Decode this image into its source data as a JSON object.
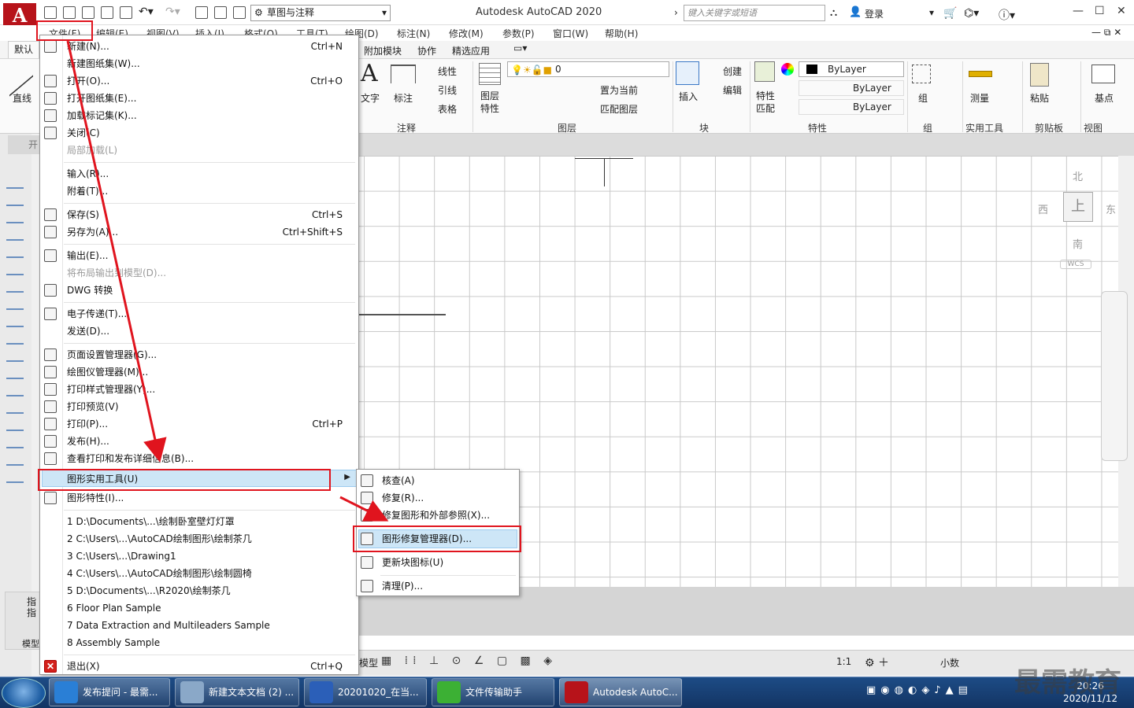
{
  "app": {
    "title": "Autodesk AutoCAD 2020",
    "logo_letter": "A",
    "workspace": "草图与注释",
    "search_placeholder": "键入关键字或短语",
    "login": "登录"
  },
  "menubar": [
    "文件(F)",
    "编辑(E)",
    "视图(V)",
    "插入(I)",
    "格式(O)",
    "工具(T)",
    "绘图(D)",
    "标注(N)",
    "修改(M)",
    "参数(P)",
    "窗口(W)",
    "帮助(H)"
  ],
  "ribbon": {
    "tabs": [
      "默认",
      "附加模块",
      "协作",
      "精选应用"
    ],
    "tools": {
      "line": "直线",
      "text": "文字",
      "dimension": "标注",
      "linear": "线性",
      "leader": "引线",
      "table": "表格",
      "layer_props": "图层特性",
      "layer_value": "0",
      "set_current": "置为当前",
      "match_layer": "匹配图层",
      "insert": "插入",
      "create": "创建",
      "edit": "编辑",
      "match_props": "特性匹配",
      "bylayer_1": "ByLayer",
      "bylayer_2": "ByLayer",
      "bylayer_3": "ByLayer",
      "group": "组",
      "measure": "测量",
      "paste": "粘贴",
      "base": "基点"
    },
    "groups": [
      "注释",
      "图层",
      "块",
      "特性",
      "组",
      "实用工具",
      "剪贴板",
      "视图"
    ]
  },
  "file_menu": {
    "items": [
      {
        "label": "新建(N)...",
        "shortcut": "Ctrl+N"
      },
      {
        "label": "新建图纸集(W)...",
        "shortcut": ""
      },
      {
        "label": "打开(O)...",
        "shortcut": "Ctrl+O"
      },
      {
        "label": "打开图纸集(E)...",
        "shortcut": ""
      },
      {
        "label": "加载标记集(K)...",
        "shortcut": ""
      },
      {
        "label": "关闭(C)",
        "shortcut": ""
      },
      {
        "label": "局部加载(L)",
        "shortcut": ""
      },
      {
        "label": "输入(R)...",
        "shortcut": ""
      },
      {
        "label": "附着(T)...",
        "shortcut": ""
      },
      {
        "label": "保存(S)",
        "shortcut": "Ctrl+S"
      },
      {
        "label": "另存为(A)...",
        "shortcut": "Ctrl+Shift+S"
      },
      {
        "label": "输出(E)...",
        "shortcut": ""
      },
      {
        "label": "将布局输出到模型(D)...",
        "shortcut": ""
      },
      {
        "label": "DWG 转换",
        "shortcut": ""
      },
      {
        "label": "电子传递(T)...",
        "shortcut": ""
      },
      {
        "label": "发送(D)...",
        "shortcut": ""
      },
      {
        "label": "页面设置管理器(G)...",
        "shortcut": ""
      },
      {
        "label": "绘图仪管理器(M)...",
        "shortcut": ""
      },
      {
        "label": "打印样式管理器(Y)...",
        "shortcut": ""
      },
      {
        "label": "打印预览(V)",
        "shortcut": ""
      },
      {
        "label": "打印(P)...",
        "shortcut": "Ctrl+P"
      },
      {
        "label": "发布(H)...",
        "shortcut": ""
      },
      {
        "label": "查看打印和发布详细信息(B)...",
        "shortcut": ""
      },
      {
        "label": "图形实用工具(U)",
        "shortcut": ""
      },
      {
        "label": "图形特性(I)...",
        "shortcut": ""
      },
      {
        "label": "退出(X)",
        "shortcut": "Ctrl+Q"
      }
    ],
    "recent": [
      "1 D:\\Documents\\...\\绘制卧室壁灯灯罩",
      "2 C:\\Users\\...\\AutoCAD绘制图形\\绘制茶几",
      "3 C:\\Users\\...\\Drawing1",
      "4 C:\\Users\\...\\AutoCAD绘制图形\\绘制圆椅",
      "5 D:\\Documents\\...\\R2020\\绘制茶几",
      "6 Floor Plan Sample",
      "7 Data Extraction and Multileaders Sample",
      "8 Assembly Sample"
    ]
  },
  "submenu": {
    "items": [
      "核查(A)",
      "修复(R)...",
      "修复图形和外部参照(X)...",
      "图形修复管理器(D)...",
      "更新块图标(U)",
      "清理(P)..."
    ]
  },
  "viewcube": {
    "north": "北",
    "south": "南",
    "east": "东",
    "west": "西",
    "top": "上",
    "wcs": "WCS"
  },
  "left_panel": {
    "model": "模型",
    "tab_open": "开",
    "cmd1": "指",
    "cmd2": "指"
  },
  "status": {
    "model": "模型",
    "scale": "1:1",
    "units": "小数"
  },
  "taskbar": {
    "items": [
      "发布提问 - 最需...",
      "新建文本文档 (2) ...",
      "20201020_在当...",
      "文件传输助手",
      "Autodesk AutoC..."
    ],
    "time": "20:26",
    "date": "2020/11/12"
  },
  "watermark": "最需教育",
  "colors": {
    "accent_red": "#e0141e",
    "highlight": "#cde6f7",
    "taskbar": "#1d4c86"
  }
}
